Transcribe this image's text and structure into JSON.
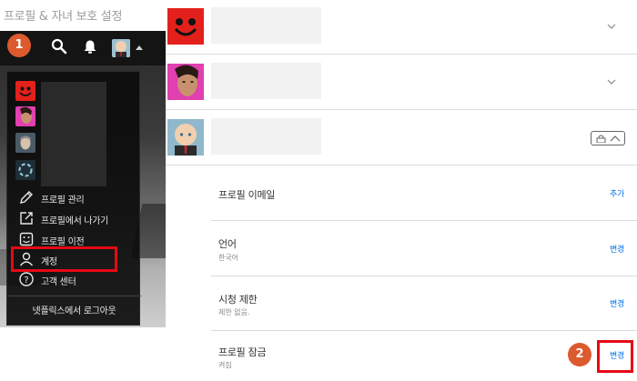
{
  "page": {
    "title": "프로필 & 자녀 보호 설정"
  },
  "step_badges": [
    "1",
    "2"
  ],
  "header": {
    "icons": [
      "search-icon",
      "bell-icon",
      "profile-avatar",
      "caret-up-icon"
    ]
  },
  "menu": {
    "items": [
      {
        "icon": "pencil-icon",
        "label": "프로필 관리"
      },
      {
        "icon": "exit-icon",
        "label": "프로필에서 나가기"
      },
      {
        "icon": "transfer-icon",
        "label": "프로필 이전"
      },
      {
        "icon": "person-icon",
        "label": "계정"
      },
      {
        "icon": "help-icon",
        "label": "고객 센터"
      }
    ],
    "logout_label": "넷플릭스에서 로그아웃"
  },
  "profiles": [
    {
      "avatar": "red-smiley-avatar",
      "expanded": false,
      "locked": false
    },
    {
      "avatar": "woman-portrait-avatar",
      "expanded": false,
      "locked": false
    },
    {
      "avatar": "boss-baby-avatar",
      "expanded": true,
      "locked": true
    }
  ],
  "settings": [
    {
      "title": "프로필 이메일",
      "value": "",
      "action": "추가"
    },
    {
      "title": "언어",
      "value": "한국어",
      "action": "변경"
    },
    {
      "title": "시청 제한",
      "value": "제한 없음.",
      "action": "변경"
    },
    {
      "title": "프로필 잠금",
      "value": "켜짐",
      "action": "변경"
    }
  ],
  "colors": {
    "accent": "#0071eb",
    "highlight": "#e50914",
    "badge": "#dc5a2e",
    "menu_bg": "#0c0c0c"
  }
}
